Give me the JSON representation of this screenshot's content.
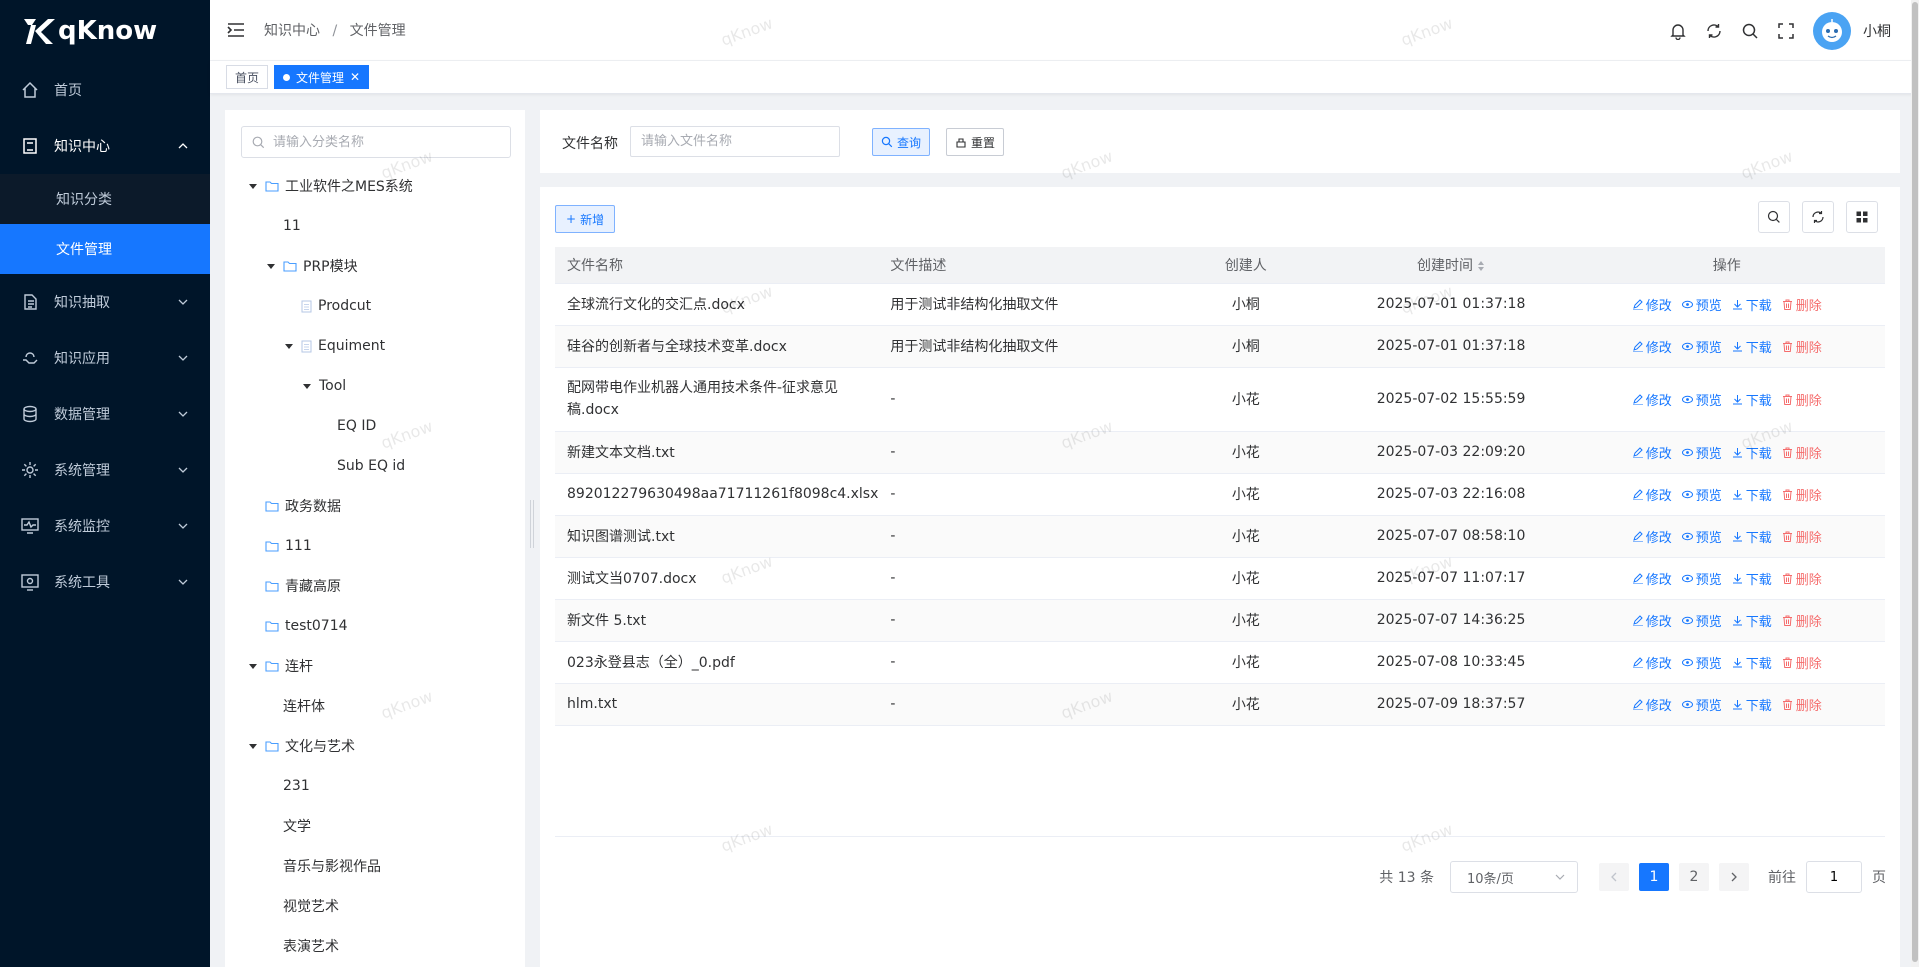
{
  "app": {
    "logo": "qKnow"
  },
  "sidebar": {
    "items": [
      {
        "label": "首页",
        "icon": "home-icon"
      },
      {
        "label": "知识中心",
        "icon": "book-icon",
        "open": true,
        "children": [
          {
            "label": "知识分类"
          },
          {
            "label": "文件管理",
            "active": true
          }
        ]
      },
      {
        "label": "知识抽取",
        "icon": "extract-icon"
      },
      {
        "label": "知识应用",
        "icon": "application-icon"
      },
      {
        "label": "数据管理",
        "icon": "database-icon"
      },
      {
        "label": "系统管理",
        "icon": "gear-icon"
      },
      {
        "label": "系统监控",
        "icon": "monitor-icon"
      },
      {
        "label": "系统工具",
        "icon": "tools-icon"
      }
    ]
  },
  "header": {
    "breadcrumb": [
      "知识中心",
      "文件管理"
    ],
    "separator": "/",
    "username": "小桐"
  },
  "tabs": [
    {
      "label": "首页"
    },
    {
      "label": "文件管理",
      "active": true
    }
  ],
  "tree": {
    "search_placeholder": "请输入分类名称",
    "nodes": [
      {
        "label": "工业软件之MES系统",
        "level": 0,
        "expanded": true,
        "icon": "folder"
      },
      {
        "label": "11",
        "level": 1,
        "icon": "none"
      },
      {
        "label": "PRP模块",
        "level": 1,
        "expanded": true,
        "icon": "folder"
      },
      {
        "label": "Prodcut",
        "level": 2,
        "icon": "file"
      },
      {
        "label": "Equiment",
        "level": 2,
        "expanded": true,
        "icon": "file"
      },
      {
        "label": "Tool",
        "level": 3,
        "expanded": true,
        "icon": "none"
      },
      {
        "label": "EQ ID",
        "level": 4,
        "icon": "none"
      },
      {
        "label": "Sub EQ id",
        "level": 4,
        "icon": "none"
      },
      {
        "label": "政务数据",
        "level": 0,
        "icon": "folder"
      },
      {
        "label": "111",
        "level": 0,
        "icon": "folder"
      },
      {
        "label": "青藏高原",
        "level": 0,
        "icon": "folder"
      },
      {
        "label": "test0714",
        "level": 0,
        "icon": "folder"
      },
      {
        "label": "连杆",
        "level": 0,
        "expanded": true,
        "icon": "folder"
      },
      {
        "label": "连杆体",
        "level": 1,
        "icon": "none"
      },
      {
        "label": "文化与艺术",
        "level": 0,
        "expanded": true,
        "icon": "folder"
      },
      {
        "label": "231",
        "level": 1,
        "icon": "none"
      },
      {
        "label": "文学",
        "level": 1,
        "icon": "none"
      },
      {
        "label": "音乐与影视作品",
        "level": 1,
        "icon": "none"
      },
      {
        "label": "视觉艺术",
        "level": 1,
        "icon": "none"
      },
      {
        "label": "表演艺术",
        "level": 1,
        "icon": "none"
      }
    ]
  },
  "query": {
    "label": "文件名称",
    "placeholder": "请输入文件名称",
    "search_label": "查询",
    "reset_label": "重置"
  },
  "table": {
    "add_label": "新增",
    "columns": [
      "文件名称",
      "文件描述",
      "创建人",
      "创建时间",
      "操作"
    ],
    "ops": {
      "edit": "修改",
      "preview": "预览",
      "download": "下载",
      "delete": "删除"
    },
    "rows": [
      {
        "name": "全球流行文化的交汇点.docx",
        "desc": "用于测试非结构化抽取文件",
        "creator": "小桐",
        "time": "2025-07-01 01:37:18"
      },
      {
        "name": "硅谷的创新者与全球技术变革.docx",
        "desc": "用于测试非结构化抽取文件",
        "creator": "小桐",
        "time": "2025-07-01 01:37:18"
      },
      {
        "name": "配网带电作业机器人通用技术条件-征求意见稿.docx",
        "desc": "-",
        "creator": "小花",
        "time": "2025-07-02 15:55:59"
      },
      {
        "name": "新建文本文档.txt",
        "desc": "-",
        "creator": "小花",
        "time": "2025-07-03 22:09:20"
      },
      {
        "name": "892012279630498aa71711261f8098c4.xlsx",
        "desc": "-",
        "creator": "小花",
        "time": "2025-07-03 22:16:08"
      },
      {
        "name": "知识图谱测试.txt",
        "desc": "-",
        "creator": "小花",
        "time": "2025-07-07 08:58:10"
      },
      {
        "name": "测试文当0707.docx",
        "desc": "-",
        "creator": "小花",
        "time": "2025-07-07 11:07:17"
      },
      {
        "name": "新文件 5.txt",
        "desc": "-",
        "creator": "小花",
        "time": "2025-07-07 14:36:25"
      },
      {
        "name": "023永登县志（全）_0.pdf",
        "desc": "-",
        "creator": "小花",
        "time": "2025-07-08 10:33:45"
      },
      {
        "name": "hlm.txt",
        "desc": "-",
        "creator": "小花",
        "time": "2025-07-09 18:37:57"
      }
    ]
  },
  "pagination": {
    "total_text": "共 13 条",
    "page_size": "10条/页",
    "pages": [
      "1",
      "2"
    ],
    "current": "1",
    "goto_label": "前往",
    "goto_value": "1",
    "page_suffix": "页"
  },
  "watermark": "qKnow"
}
